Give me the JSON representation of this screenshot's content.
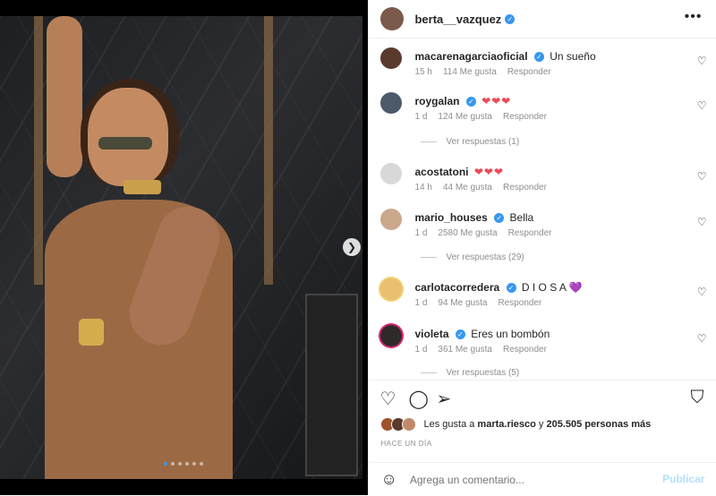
{
  "post": {
    "author": "berta__vazquez",
    "more_icon": "more-horizontal-icon"
  },
  "photo": {
    "next_icon": "chevron-right-icon",
    "carousel_count": 6,
    "carousel_active": 1
  },
  "comments": [
    {
      "user": "macarenagarciaoficial",
      "verified": true,
      "text": "Un sueño",
      "hearts": "",
      "time": "15 h",
      "likes": "114 Me gusta",
      "reply": "Responder",
      "view_replies": ""
    },
    {
      "user": "roygalan",
      "verified": true,
      "text": "",
      "hearts": "❤❤❤",
      "time": "1 d",
      "likes": "124 Me gusta",
      "reply": "Responder",
      "view_replies": "Ver respuestas (1)"
    },
    {
      "user": "acostatoni",
      "verified": false,
      "text": "",
      "hearts": "❤❤❤",
      "time": "14 h",
      "likes": "44 Me gusta",
      "reply": "Responder",
      "view_replies": ""
    },
    {
      "user": "mario_houses",
      "verified": true,
      "text": "Bella",
      "hearts": "",
      "time": "1 d",
      "likes": "2580 Me gusta",
      "reply": "Responder",
      "view_replies": "Ver respuestas (29)"
    },
    {
      "user": "carlotacorredera",
      "verified": true,
      "text": "D I O S A",
      "hearts": "💜",
      "time": "1 d",
      "likes": "94 Me gusta",
      "reply": "Responder",
      "view_replies": ""
    },
    {
      "user": "violeta",
      "verified": true,
      "text": "Eres un bombón",
      "hearts": "",
      "time": "1 d",
      "likes": "361 Me gusta",
      "reply": "Responder",
      "view_replies": "Ver respuestas (5)"
    }
  ],
  "likes": {
    "prefix": "Les gusta a",
    "user": "marta.riesco",
    "joiner": "y",
    "count": "205.505 personas más"
  },
  "time_ago": "HACE UN DÍA",
  "comment_box": {
    "placeholder": "Agrega un comentario...",
    "post_label": "Publicar"
  },
  "colors": {
    "verified": "#3897f0",
    "heart": "#ed4956",
    "post_button": "#b2dffc",
    "muted": "#8e8e8e"
  }
}
